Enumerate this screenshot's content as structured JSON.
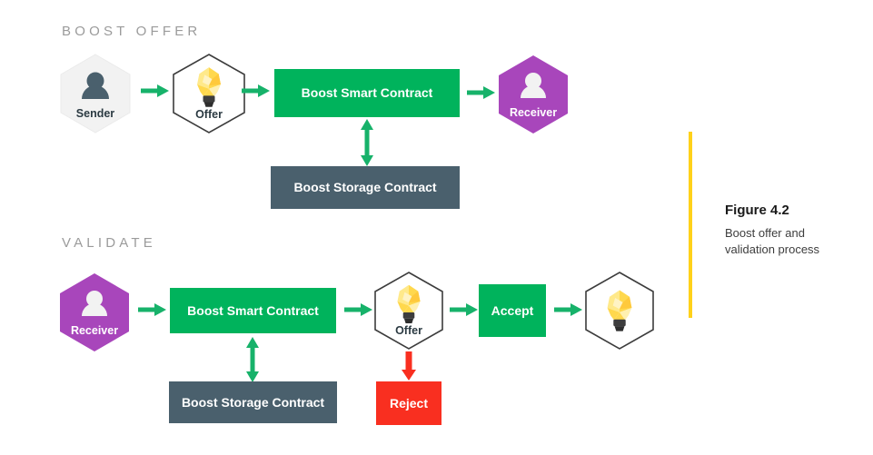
{
  "diagram": {
    "sections": [
      {
        "id": "boost-offer",
        "title": "BOOST OFFER"
      },
      {
        "id": "validate",
        "title": "VALIDATE"
      }
    ],
    "nodes": {
      "sender": {
        "label": "Sender",
        "icon": "person-icon",
        "shape": "hexagon",
        "fill": "#f2f2f2"
      },
      "offer_top": {
        "label": "Offer",
        "icon": "lightbulb-icon",
        "shape": "hexagon",
        "fill": "#ffffff"
      },
      "smart_contract_top": {
        "label": "Boost Smart Contract",
        "shape": "rect",
        "fill": "#00b35c"
      },
      "storage_contract_top": {
        "label": "Boost Storage Contract",
        "shape": "rect",
        "fill": "#4a606d"
      },
      "receiver_top": {
        "label": "Receiver",
        "icon": "person-icon",
        "shape": "hexagon",
        "fill": "#a846bb"
      },
      "receiver_bottom": {
        "label": "Receiver",
        "icon": "person-icon",
        "shape": "hexagon",
        "fill": "#a846bb"
      },
      "smart_contract_bottom": {
        "label": "Boost Smart Contract",
        "shape": "rect",
        "fill": "#00b35c"
      },
      "storage_contract_bottom": {
        "label": "Boost Storage Contract",
        "shape": "rect",
        "fill": "#4a606d"
      },
      "offer_bottom": {
        "label": "Offer",
        "icon": "lightbulb-icon",
        "shape": "hexagon",
        "fill": "#ffffff"
      },
      "accept": {
        "label": "Accept",
        "shape": "rect",
        "fill": "#00b35c"
      },
      "reject": {
        "label": "Reject",
        "shape": "rect",
        "fill": "#f92f20"
      },
      "offer_result": {
        "label": "",
        "icon": "lightbulb-icon",
        "shape": "hexagon",
        "fill": "#ffffff"
      }
    },
    "colors": {
      "green": "#00b35c",
      "slate": "#4a606d",
      "red": "#f92f20",
      "purple": "#a846bb",
      "gray": "#f2f2f2",
      "yellow": "#ffd11a",
      "header": "#9b9b9b"
    }
  },
  "caption": {
    "figure_number": "Figure 4.2",
    "description": "Boost offer and validation process"
  }
}
